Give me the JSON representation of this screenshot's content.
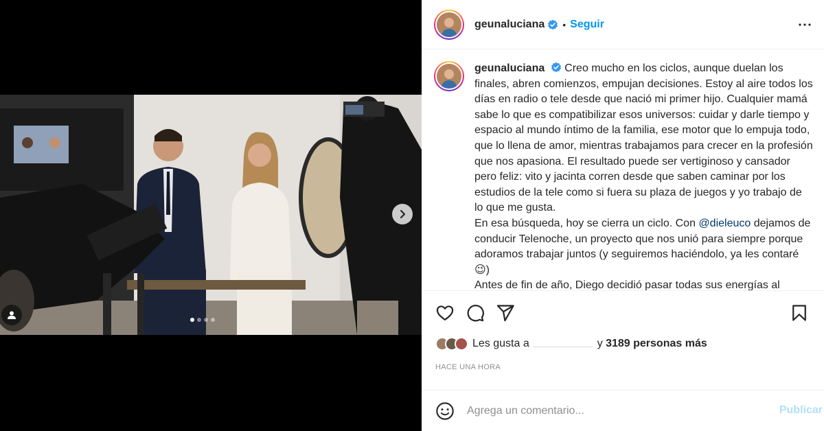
{
  "header": {
    "username": "geunaluciana",
    "separator": "•",
    "follow_label": "Seguir"
  },
  "caption": {
    "username": "geunaluciana",
    "text_1": "Creo mucho en los ciclos, aunque duelan los finales, abren comienzos, empujan decisiones. Estoy al aire todos los días en radio o tele desde que nació mi primer hijo. Cualquier mamá sabe lo que es compatibilizar esos universos: cuidar y darle tiempo y espacio al mundo íntimo de la familia, ese motor que lo empuja todo, que lo llena de amor, mientras trabajamos para crecer en la profesión que nos apasiona. El resultado puede ser vertiginoso y cansador pero feliz: vito y jacinta corren desde que saben caminar por los estudios de la tele como si fuera su plaza de juegos y yo trabajo de lo que me gusta.",
    "text_2": "En esa búsqueda, hoy se cierra un ciclo. Con",
    "mention": "@dieleuco",
    "text_3": "dejamos de conducir Telenoche, un proyecto que nos unió para siempre porque adoramos trabajar juntos (y seguiremos haciéndolo, ya les contaré 😉)",
    "text_4": "Antes de fin de año, Diego decidió pasar todas sus energías al"
  },
  "likes": {
    "prefix": "Les gusta a",
    "suffix": "y",
    "count_text": "3189 personas más"
  },
  "timestamp": "HACE UNA HORA",
  "comment": {
    "placeholder": "Agrega un comentario...",
    "publish_label": "Publicar"
  },
  "carousel": {
    "slide_count": 4,
    "active_index": 0
  },
  "icons": {
    "verified": "verified-badge-icon",
    "more": "more-options-icon",
    "like": "heart-icon",
    "comment": "comment-icon",
    "share": "paper-plane-icon",
    "save": "bookmark-icon",
    "emoji": "emoji-icon",
    "next": "chevron-right-icon",
    "tag": "person-tag-icon"
  },
  "colors": {
    "follow": "#0095f6",
    "verified": "#3897f0",
    "publish_disabled": "#b2dffc",
    "mention": "#00376b"
  }
}
